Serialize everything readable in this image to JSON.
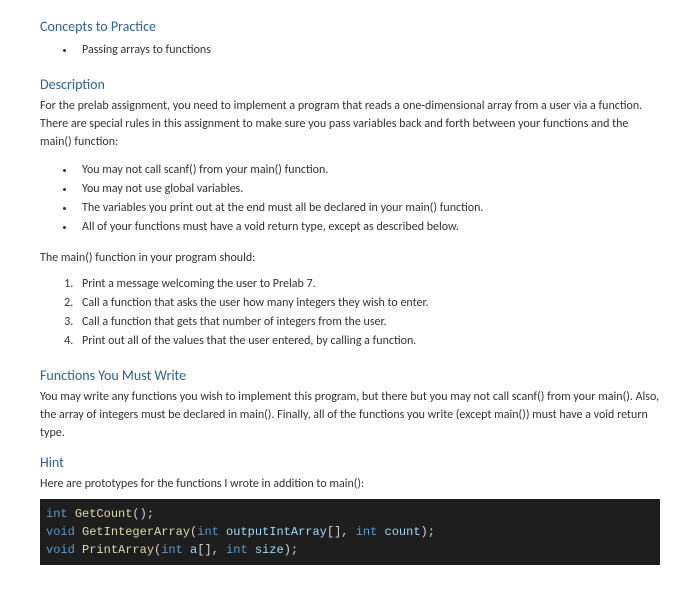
{
  "concepts": {
    "heading": "Concepts to Practice",
    "items": [
      "Passing arrays to functions"
    ]
  },
  "description": {
    "heading": "Description",
    "intro": "For the prelab assignment, you need to implement a program that reads a one-dimensional array from a user via a function.  There are special rules in this assignment to make sure you pass variables back and forth between your functions and the main() function:",
    "rules": [
      "You may not call scanf() from your main() function.",
      "You may not use global variables.",
      "The variables you print out at the end must all be declared in your main() function.",
      "All of your functions must have a void return type, except as described below."
    ],
    "main_intro": "The main() function in your program should:",
    "main_steps": [
      "Print a message welcoming the user to Prelab 7.",
      "Call a function that asks the user how many integers they wish to enter.",
      "Call a function that gets that number of integers from the user.",
      "Print out all of the values that the user entered, by calling a function."
    ]
  },
  "functions": {
    "heading": "Functions You Must Write",
    "body": "You may write any functions you wish to implement this program, but there but you may not call scanf() from your main().  Also, the array of integers must be declared in main().  Finally, all of the functions you write (except main()) must have a void return type."
  },
  "hint": {
    "heading": "Hint",
    "body": "Here are prototypes for the functions I wrote in addition to main():"
  },
  "code": {
    "line1_type": "int",
    "line1_func": "GetCount",
    "line1_rest": "();",
    "line2_type1": "void",
    "line2_func": "GetIntegerArray",
    "line2_open": "(",
    "line2_type2": "int",
    "line2_var1": " outputIntArray",
    "line2_brackets": "[], ",
    "line2_type3": "int",
    "line2_var2": " count",
    "line2_close": ");",
    "line3_type1": "void",
    "line3_func": "PrintArray",
    "line3_open": "(",
    "line3_type2": "int",
    "line3_var1": " a",
    "line3_brackets": "[], ",
    "line3_type3": "int",
    "line3_var2": " size",
    "line3_close": ");"
  }
}
